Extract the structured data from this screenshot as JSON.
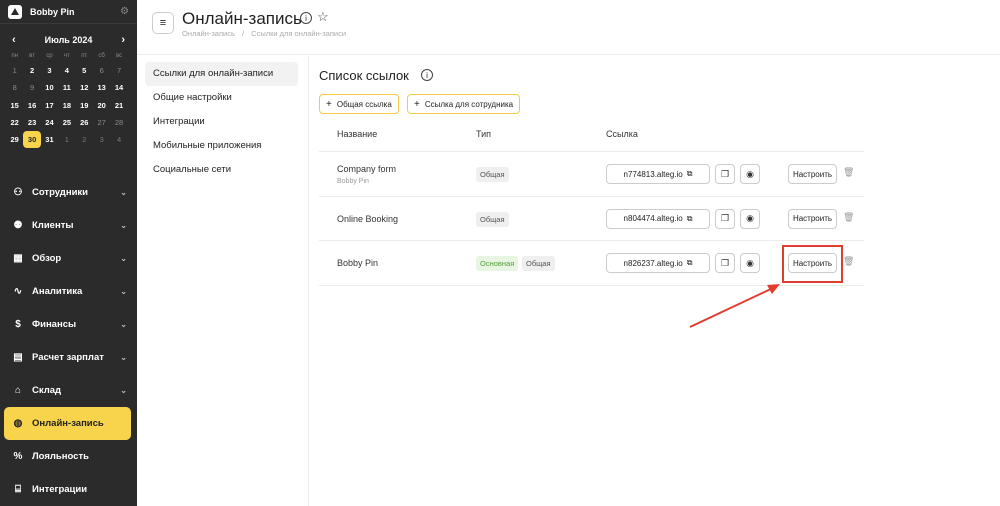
{
  "sidebar": {
    "company": "Bobby Pin",
    "calendar": {
      "month": "Июль 2024",
      "weekdays": [
        "пн",
        "вт",
        "ср",
        "чт",
        "пт",
        "сб",
        "вс"
      ],
      "days": [
        {
          "d": "1",
          "s": "dim"
        },
        {
          "d": "2",
          "s": ""
        },
        {
          "d": "3",
          "s": ""
        },
        {
          "d": "4",
          "s": ""
        },
        {
          "d": "5",
          "s": ""
        },
        {
          "d": "6",
          "s": "dim"
        },
        {
          "d": "7",
          "s": "dim"
        },
        {
          "d": "8",
          "s": "dim"
        },
        {
          "d": "9",
          "s": "dim"
        },
        {
          "d": "10",
          "s": ""
        },
        {
          "d": "11",
          "s": ""
        },
        {
          "d": "12",
          "s": ""
        },
        {
          "d": "13",
          "s": ""
        },
        {
          "d": "14",
          "s": ""
        },
        {
          "d": "15",
          "s": ""
        },
        {
          "d": "16",
          "s": ""
        },
        {
          "d": "17",
          "s": ""
        },
        {
          "d": "18",
          "s": ""
        },
        {
          "d": "19",
          "s": ""
        },
        {
          "d": "20",
          "s": ""
        },
        {
          "d": "21",
          "s": ""
        },
        {
          "d": "22",
          "s": ""
        },
        {
          "d": "23",
          "s": ""
        },
        {
          "d": "24",
          "s": ""
        },
        {
          "d": "25",
          "s": ""
        },
        {
          "d": "26",
          "s": ""
        },
        {
          "d": "27",
          "s": "dim"
        },
        {
          "d": "28",
          "s": "dim"
        },
        {
          "d": "29",
          "s": ""
        },
        {
          "d": "30",
          "s": "today"
        },
        {
          "d": "31",
          "s": ""
        },
        {
          "d": "1",
          "s": "muted"
        },
        {
          "d": "2",
          "s": "muted"
        },
        {
          "d": "3",
          "s": "muted"
        },
        {
          "d": "4",
          "s": "muted"
        }
      ]
    },
    "nav": [
      {
        "label": "Сотрудники",
        "icon": "user-icon",
        "glyph": "⚇",
        "chevron": true,
        "active": false
      },
      {
        "label": "Клиенты",
        "icon": "clients-icon",
        "glyph": "⚉",
        "chevron": true,
        "active": false
      },
      {
        "label": "Обзор",
        "icon": "overview-icon",
        "glyph": "▦",
        "chevron": true,
        "active": false
      },
      {
        "label": "Аналитика",
        "icon": "analytics-icon",
        "glyph": "∿",
        "chevron": true,
        "active": false
      },
      {
        "label": "Финансы",
        "icon": "finance-icon",
        "glyph": "$",
        "chevron": true,
        "active": false
      },
      {
        "label": "Расчет зарплат",
        "icon": "payroll-icon",
        "glyph": "▤",
        "chevron": true,
        "active": false
      },
      {
        "label": "Склад",
        "icon": "warehouse-icon",
        "glyph": "⌂",
        "chevron": true,
        "active": false
      },
      {
        "label": "Онлайн-запись",
        "icon": "globe-icon",
        "glyph": "◍",
        "chevron": false,
        "active": true
      },
      {
        "label": "Лояльность",
        "icon": "loyalty-icon",
        "glyph": "%",
        "chevron": false,
        "active": false
      },
      {
        "label": "Интеграции",
        "icon": "integrations-icon",
        "glyph": "⌸",
        "chevron": false,
        "active": false
      }
    ]
  },
  "header": {
    "title": "Онлайн-запись",
    "breadcrumbs": [
      "Онлайн-запись",
      "/",
      "Ссылки для онлайн-записи"
    ]
  },
  "settings_menu": [
    {
      "label": "Ссылки для онлайн-записи",
      "active": true
    },
    {
      "label": "Общие настройки",
      "active": false
    },
    {
      "label": "Интеграции",
      "active": false
    },
    {
      "label": "Мобильные приложения",
      "active": false
    },
    {
      "label": "Социальные сети",
      "active": false
    }
  ],
  "list": {
    "title": "Список ссылок",
    "add_common": "Общая ссылка",
    "add_employee": "Ссылка для сотрудника",
    "columns": {
      "name": "Название",
      "type": "Тип",
      "link": "Ссылка"
    },
    "configure_label": "Настроить",
    "rows": [
      {
        "name": "Company form",
        "sub": "Bobby Pin",
        "badges": [
          {
            "text": "Общая",
            "style": ""
          }
        ],
        "link": "n774813.alteg.io"
      },
      {
        "name": "Online Booking",
        "sub": "",
        "badges": [
          {
            "text": "Общая",
            "style": ""
          }
        ],
        "link": "n804474.alteg.io"
      },
      {
        "name": "Bobby Pin",
        "sub": "",
        "badges": [
          {
            "text": "Основная",
            "style": "green"
          },
          {
            "text": "Общая",
            "style": ""
          }
        ],
        "link": "n826237.alteg.io"
      }
    ]
  },
  "colors": {
    "accent": "#f7d44c",
    "sidebar_bg": "#2b2b2b",
    "annotation_red": "#e03c2f"
  }
}
